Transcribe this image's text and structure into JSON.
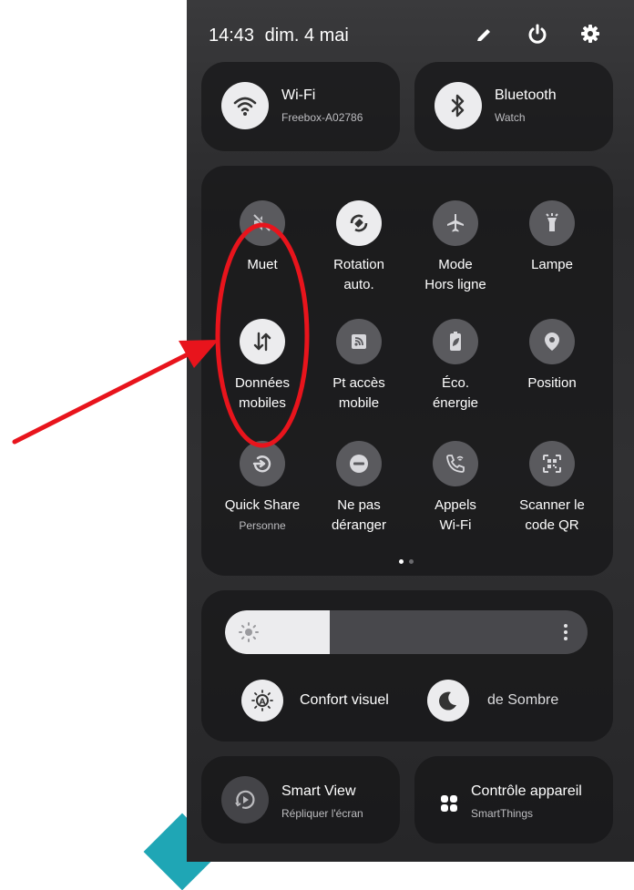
{
  "status_bar": {
    "time": "14:43",
    "date": "dim. 4 mai",
    "icons": [
      "pencil-icon",
      "power-icon",
      "gear-icon"
    ]
  },
  "connectivity": {
    "wifi": {
      "title": "Wi-Fi",
      "subtitle": "Freebox-A02786",
      "icon": "wifi-icon",
      "active": true
    },
    "bluetooth": {
      "title": "Bluetooth",
      "subtitle": "Watch",
      "icon": "bluetooth-icon",
      "active": true
    }
  },
  "quick_tiles": [
    {
      "id": "mute",
      "label1": "Muet",
      "label2": "",
      "sub": "",
      "icon": "mute-icon",
      "active": false
    },
    {
      "id": "rotation",
      "label1": "Rotation",
      "label2": "auto.",
      "sub": "",
      "icon": "rotation-icon",
      "active": true
    },
    {
      "id": "airplane",
      "label1": "Mode",
      "label2": "Hors ligne",
      "sub": "",
      "icon": "airplane-icon",
      "active": false
    },
    {
      "id": "flashlight",
      "label1": "Lampe",
      "label2": "",
      "sub": "",
      "icon": "flashlight-icon",
      "active": false
    },
    {
      "id": "mobile-data",
      "label1": "Données",
      "label2": "mobiles",
      "sub": "",
      "icon": "mobile-data-icon",
      "active": true
    },
    {
      "id": "hotspot",
      "label1": "Pt accès",
      "label2": "mobile",
      "sub": "",
      "icon": "hotspot-icon",
      "active": false
    },
    {
      "id": "power-saving",
      "label1": "Éco.",
      "label2": "énergie",
      "sub": "",
      "icon": "battery-leaf-icon",
      "active": false
    },
    {
      "id": "location",
      "label1": "Position",
      "label2": "",
      "sub": "",
      "icon": "location-pin-icon",
      "active": false
    },
    {
      "id": "quick-share",
      "label1": "Quick Share",
      "label2": "",
      "sub": "Personne",
      "icon": "quick-share-icon",
      "active": false
    },
    {
      "id": "dnd",
      "label1": "Ne pas",
      "label2": "déranger",
      "sub": "",
      "icon": "do-not-disturb-icon",
      "active": false
    },
    {
      "id": "wifi-calling",
      "label1": "Appels",
      "label2": "Wi-Fi",
      "sub": "",
      "icon": "wifi-calling-icon",
      "active": false
    },
    {
      "id": "qr",
      "label1": "Scanner le",
      "label2": "code QR",
      "sub": "",
      "icon": "qr-scanner-icon",
      "active": false
    }
  ],
  "page_indicator": {
    "current": 1,
    "total": 2
  },
  "brightness": {
    "level_percent": 29,
    "icon": "sun-icon",
    "menu_icon": "more-vertical-icon"
  },
  "display_modes": {
    "eye_comfort": {
      "label": "Confort visuel",
      "icon": "eye-comfort-icon"
    },
    "dark_mode": {
      "label": "de Sombre",
      "icon": "moon-icon"
    }
  },
  "bottom_cards": {
    "smart_view": {
      "title": "Smart View",
      "subtitle": "Répliquer l'écran",
      "icon": "smart-view-icon"
    },
    "device_control": {
      "title": "Contrôle appareil",
      "subtitle": "SmartThings",
      "icon": "device-grid-icon"
    }
  },
  "annotation": {
    "color": "#e8141c"
  }
}
